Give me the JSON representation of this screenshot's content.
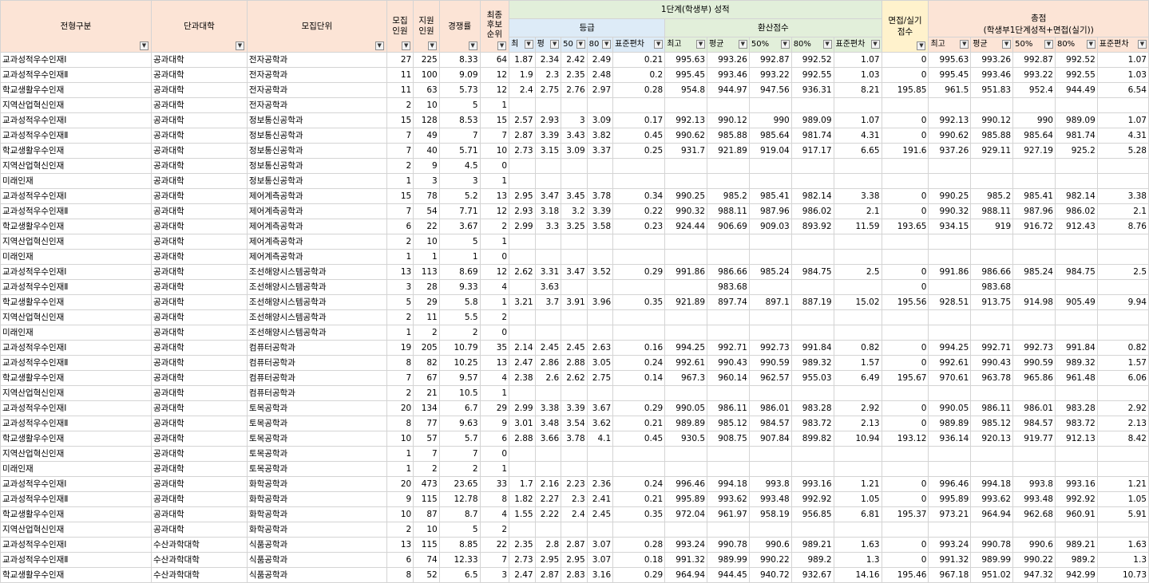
{
  "headers": {
    "c1": "전형구분",
    "c2": "단과대학",
    "c3": "모집단위",
    "c4": "모집\n인원",
    "c5": "지원\n인원",
    "c6": "경쟁률",
    "c7": "최종\n후보\n순위",
    "grp1": "1단계(학생부) 성적",
    "grp1a": "등급",
    "grp1b": "환산점수",
    "interview": "면접/실기\n점수",
    "total": "총점\n(학생부1단계성적+면접(실기))",
    "sub_grade": [
      "최",
      "평",
      "50",
      "80",
      "표준편차"
    ],
    "sub_conv": [
      "최고",
      "평균",
      "50%",
      "80%",
      "표준편차"
    ],
    "sub_total": [
      "최고",
      "평균",
      "50%",
      "80%",
      "표준편차"
    ]
  },
  "icons": {
    "filter_active": "filter-active-icon",
    "dropdown": "dropdown-arrow-icon"
  },
  "rows": [
    [
      "교과성적우수인재Ⅰ",
      "공과대학",
      "전자공학과",
      "27",
      "225",
      "8.33",
      "64",
      "1.87",
      "2.34",
      "2.42",
      "2.49",
      "0.21",
      "995.63",
      "993.26",
      "992.87",
      "992.52",
      "1.07",
      "0",
      "995.63",
      "993.26",
      "992.87",
      "992.52",
      "1.07"
    ],
    [
      "교과성적우수인재Ⅱ",
      "공과대학",
      "전자공학과",
      "11",
      "100",
      "9.09",
      "12",
      "1.9",
      "2.3",
      "2.35",
      "2.48",
      "0.2",
      "995.45",
      "993.46",
      "993.22",
      "992.55",
      "1.03",
      "0",
      "995.45",
      "993.46",
      "993.22",
      "992.55",
      "1.03"
    ],
    [
      "학교생활우수인재",
      "공과대학",
      "전자공학과",
      "11",
      "63",
      "5.73",
      "12",
      "2.4",
      "2.75",
      "2.76",
      "2.97",
      "0.28",
      "954.8",
      "944.97",
      "947.56",
      "936.31",
      "8.21",
      "195.85",
      "961.5",
      "951.83",
      "952.4",
      "944.49",
      "6.54"
    ],
    [
      "지역산업혁신인재",
      "공과대학",
      "전자공학과",
      "2",
      "10",
      "5",
      "1",
      "",
      "",
      "",
      "",
      "",
      "",
      "",
      "",
      "",
      "",
      "",
      "",
      "",
      "",
      "",
      ""
    ],
    [
      "교과성적우수인재Ⅰ",
      "공과대학",
      "정보통신공학과",
      "15",
      "128",
      "8.53",
      "15",
      "2.57",
      "2.93",
      "3",
      "3.09",
      "0.17",
      "992.13",
      "990.12",
      "990",
      "989.09",
      "1.07",
      "0",
      "992.13",
      "990.12",
      "990",
      "989.09",
      "1.07"
    ],
    [
      "교과성적우수인재Ⅱ",
      "공과대학",
      "정보통신공학과",
      "7",
      "49",
      "7",
      "7",
      "2.87",
      "3.39",
      "3.43",
      "3.82",
      "0.45",
      "990.62",
      "985.88",
      "985.64",
      "981.74",
      "4.31",
      "0",
      "990.62",
      "985.88",
      "985.64",
      "981.74",
      "4.31"
    ],
    [
      "학교생활우수인재",
      "공과대학",
      "정보통신공학과",
      "7",
      "40",
      "5.71",
      "10",
      "2.73",
      "3.15",
      "3.09",
      "3.37",
      "0.25",
      "931.7",
      "921.89",
      "919.04",
      "917.17",
      "6.65",
      "191.6",
      "937.26",
      "929.11",
      "927.19",
      "925.2",
      "5.28"
    ],
    [
      "지역산업혁신인재",
      "공과대학",
      "정보통신공학과",
      "2",
      "9",
      "4.5",
      "0",
      "",
      "",
      "",
      "",
      "",
      "",
      "",
      "",
      "",
      "",
      "",
      "",
      "",
      "",
      "",
      ""
    ],
    [
      "미래인재",
      "공과대학",
      "정보통신공학과",
      "1",
      "3",
      "3",
      "1",
      "",
      "",
      "",
      "",
      "",
      "",
      "",
      "",
      "",
      "",
      "",
      "",
      "",
      "",
      "",
      ""
    ],
    [
      "교과성적우수인재Ⅰ",
      "공과대학",
      "제어계측공학과",
      "15",
      "78",
      "5.2",
      "13",
      "2.95",
      "3.47",
      "3.45",
      "3.78",
      "0.34",
      "990.25",
      "985.2",
      "985.41",
      "982.14",
      "3.38",
      "0",
      "990.25",
      "985.2",
      "985.41",
      "982.14",
      "3.38"
    ],
    [
      "교과성적우수인재Ⅱ",
      "공과대학",
      "제어계측공학과",
      "7",
      "54",
      "7.71",
      "12",
      "2.93",
      "3.18",
      "3.2",
      "3.39",
      "0.22",
      "990.32",
      "988.11",
      "987.96",
      "986.02",
      "2.1",
      "0",
      "990.32",
      "988.11",
      "987.96",
      "986.02",
      "2.1"
    ],
    [
      "학교생활우수인재",
      "공과대학",
      "제어계측공학과",
      "6",
      "22",
      "3.67",
      "2",
      "2.99",
      "3.3",
      "3.25",
      "3.58",
      "0.23",
      "924.44",
      "906.69",
      "909.03",
      "893.92",
      "11.59",
      "193.65",
      "934.15",
      "919",
      "916.72",
      "912.43",
      "8.76"
    ],
    [
      "지역산업혁신인재",
      "공과대학",
      "제어계측공학과",
      "2",
      "10",
      "5",
      "1",
      "",
      "",
      "",
      "",
      "",
      "",
      "",
      "",
      "",
      "",
      "",
      "",
      "",
      "",
      "",
      ""
    ],
    [
      "미래인재",
      "공과대학",
      "제어계측공학과",
      "1",
      "1",
      "1",
      "0",
      "",
      "",
      "",
      "",
      "",
      "",
      "",
      "",
      "",
      "",
      "",
      "",
      "",
      "",
      "",
      ""
    ],
    [
      "교과성적우수인재Ⅰ",
      "공과대학",
      "조선해양시스템공학과",
      "13",
      "113",
      "8.69",
      "12",
      "2.62",
      "3.31",
      "3.47",
      "3.52",
      "0.29",
      "991.86",
      "986.66",
      "985.24",
      "984.75",
      "2.5",
      "0",
      "991.86",
      "986.66",
      "985.24",
      "984.75",
      "2.5"
    ],
    [
      "교과성적우수인재Ⅱ",
      "공과대학",
      "조선해양시스템공학과",
      "3",
      "28",
      "9.33",
      "4",
      "",
      "3.63",
      "",
      "",
      "",
      "",
      "983.68",
      "",
      "",
      "",
      "0",
      "",
      "983.68",
      "",
      "",
      ""
    ],
    [
      "학교생활우수인재",
      "공과대학",
      "조선해양시스템공학과",
      "5",
      "29",
      "5.8",
      "1",
      "3.21",
      "3.7",
      "3.91",
      "3.96",
      "0.35",
      "921.89",
      "897.74",
      "897.1",
      "887.19",
      "15.02",
      "195.56",
      "928.51",
      "913.75",
      "914.98",
      "905.49",
      "9.94"
    ],
    [
      "지역산업혁신인재",
      "공과대학",
      "조선해양시스템공학과",
      "2",
      "11",
      "5.5",
      "2",
      "",
      "",
      "",
      "",
      "",
      "",
      "",
      "",
      "",
      "",
      "",
      "",
      "",
      "",
      "",
      ""
    ],
    [
      "미래인재",
      "공과대학",
      "조선해양시스템공학과",
      "1",
      "2",
      "2",
      "0",
      "",
      "",
      "",
      "",
      "",
      "",
      "",
      "",
      "",
      "",
      "",
      "",
      "",
      "",
      "",
      ""
    ],
    [
      "교과성적우수인재Ⅰ",
      "공과대학",
      "컴퓨터공학과",
      "19",
      "205",
      "10.79",
      "35",
      "2.14",
      "2.45",
      "2.45",
      "2.63",
      "0.16",
      "994.25",
      "992.71",
      "992.73",
      "991.84",
      "0.82",
      "0",
      "994.25",
      "992.71",
      "992.73",
      "991.84",
      "0.82"
    ],
    [
      "교과성적우수인재Ⅱ",
      "공과대학",
      "컴퓨터공학과",
      "8",
      "82",
      "10.25",
      "13",
      "2.47",
      "2.86",
      "2.88",
      "3.05",
      "0.24",
      "992.61",
      "990.43",
      "990.59",
      "989.32",
      "1.57",
      "0",
      "992.61",
      "990.43",
      "990.59",
      "989.32",
      "1.57"
    ],
    [
      "학교생활우수인재",
      "공과대학",
      "컴퓨터공학과",
      "7",
      "67",
      "9.57",
      "4",
      "2.38",
      "2.6",
      "2.62",
      "2.75",
      "0.14",
      "967.3",
      "960.14",
      "962.57",
      "955.03",
      "6.49",
      "195.67",
      "970.61",
      "963.78",
      "965.86",
      "961.48",
      "6.06"
    ],
    [
      "지역산업혁신인재",
      "공과대학",
      "컴퓨터공학과",
      "2",
      "21",
      "10.5",
      "1",
      "",
      "",
      "",
      "",
      "",
      "",
      "",
      "",
      "",
      "",
      "",
      "",
      "",
      "",
      "",
      ""
    ],
    [
      "교과성적우수인재Ⅰ",
      "공과대학",
      "토목공학과",
      "20",
      "134",
      "6.7",
      "29",
      "2.99",
      "3.38",
      "3.39",
      "3.67",
      "0.29",
      "990.05",
      "986.11",
      "986.01",
      "983.28",
      "2.92",
      "0",
      "990.05",
      "986.11",
      "986.01",
      "983.28",
      "2.92"
    ],
    [
      "교과성적우수인재Ⅱ",
      "공과대학",
      "토목공학과",
      "8",
      "77",
      "9.63",
      "9",
      "3.01",
      "3.48",
      "3.54",
      "3.62",
      "0.21",
      "989.89",
      "985.12",
      "984.57",
      "983.72",
      "2.13",
      "0",
      "989.89",
      "985.12",
      "984.57",
      "983.72",
      "2.13"
    ],
    [
      "학교생활우수인재",
      "공과대학",
      "토목공학과",
      "10",
      "57",
      "5.7",
      "6",
      "2.88",
      "3.66",
      "3.78",
      "4.1",
      "0.45",
      "930.5",
      "908.75",
      "907.84",
      "899.82",
      "10.94",
      "193.12",
      "936.14",
      "920.13",
      "919.77",
      "912.13",
      "8.42"
    ],
    [
      "지역산업혁신인재",
      "공과대학",
      "토목공학과",
      "1",
      "7",
      "7",
      "0",
      "",
      "",
      "",
      "",
      "",
      "",
      "",
      "",
      "",
      "",
      "",
      "",
      "",
      "",
      "",
      ""
    ],
    [
      "미래인재",
      "공과대학",
      "토목공학과",
      "1",
      "2",
      "2",
      "1",
      "",
      "",
      "",
      "",
      "",
      "",
      "",
      "",
      "",
      "",
      "",
      "",
      "",
      "",
      "",
      ""
    ],
    [
      "교과성적우수인재Ⅰ",
      "공과대학",
      "화학공학과",
      "20",
      "473",
      "23.65",
      "33",
      "1.7",
      "2.16",
      "2.23",
      "2.36",
      "0.24",
      "996.46",
      "994.18",
      "993.8",
      "993.16",
      "1.21",
      "0",
      "996.46",
      "994.18",
      "993.8",
      "993.16",
      "1.21"
    ],
    [
      "교과성적우수인재Ⅱ",
      "공과대학",
      "화학공학과",
      "9",
      "115",
      "12.78",
      "8",
      "1.82",
      "2.27",
      "2.3",
      "2.41",
      "0.21",
      "995.89",
      "993.62",
      "993.48",
      "992.92",
      "1.05",
      "0",
      "995.89",
      "993.62",
      "993.48",
      "992.92",
      "1.05"
    ],
    [
      "학교생활우수인재",
      "공과대학",
      "화학공학과",
      "10",
      "87",
      "8.7",
      "4",
      "1.55",
      "2.22",
      "2.4",
      "2.45",
      "0.35",
      "972.04",
      "961.97",
      "958.19",
      "956.85",
      "6.81",
      "195.37",
      "973.21",
      "964.94",
      "962.68",
      "960.91",
      "5.91"
    ],
    [
      "지역산업혁신인재",
      "공과대학",
      "화학공학과",
      "2",
      "10",
      "5",
      "2",
      "",
      "",
      "",
      "",
      "",
      "",
      "",
      "",
      "",
      "",
      "",
      "",
      "",
      "",
      "",
      ""
    ],
    [
      "교과성적우수인재Ⅰ",
      "수산과학대학",
      "식품공학과",
      "13",
      "115",
      "8.85",
      "22",
      "2.35",
      "2.8",
      "2.87",
      "3.07",
      "0.28",
      "993.24",
      "990.78",
      "990.6",
      "989.21",
      "1.63",
      "0",
      "993.24",
      "990.78",
      "990.6",
      "989.21",
      "1.63"
    ],
    [
      "교과성적우수인재Ⅱ",
      "수산과학대학",
      "식품공학과",
      "6",
      "74",
      "12.33",
      "7",
      "2.73",
      "2.95",
      "2.95",
      "3.07",
      "0.18",
      "991.32",
      "989.99",
      "990.22",
      "989.2",
      "1.3",
      "0",
      "991.32",
      "989.99",
      "990.22",
      "989.2",
      "1.3"
    ],
    [
      "학교생활우수인재",
      "수산과학대학",
      "식품공학과",
      "8",
      "52",
      "6.5",
      "3",
      "2.47",
      "2.87",
      "2.83",
      "3.16",
      "0.29",
      "964.94",
      "944.45",
      "940.72",
      "932.67",
      "14.16",
      "195.46",
      "967.18",
      "951.02",
      "947.32",
      "942.99",
      "10.73"
    ]
  ]
}
